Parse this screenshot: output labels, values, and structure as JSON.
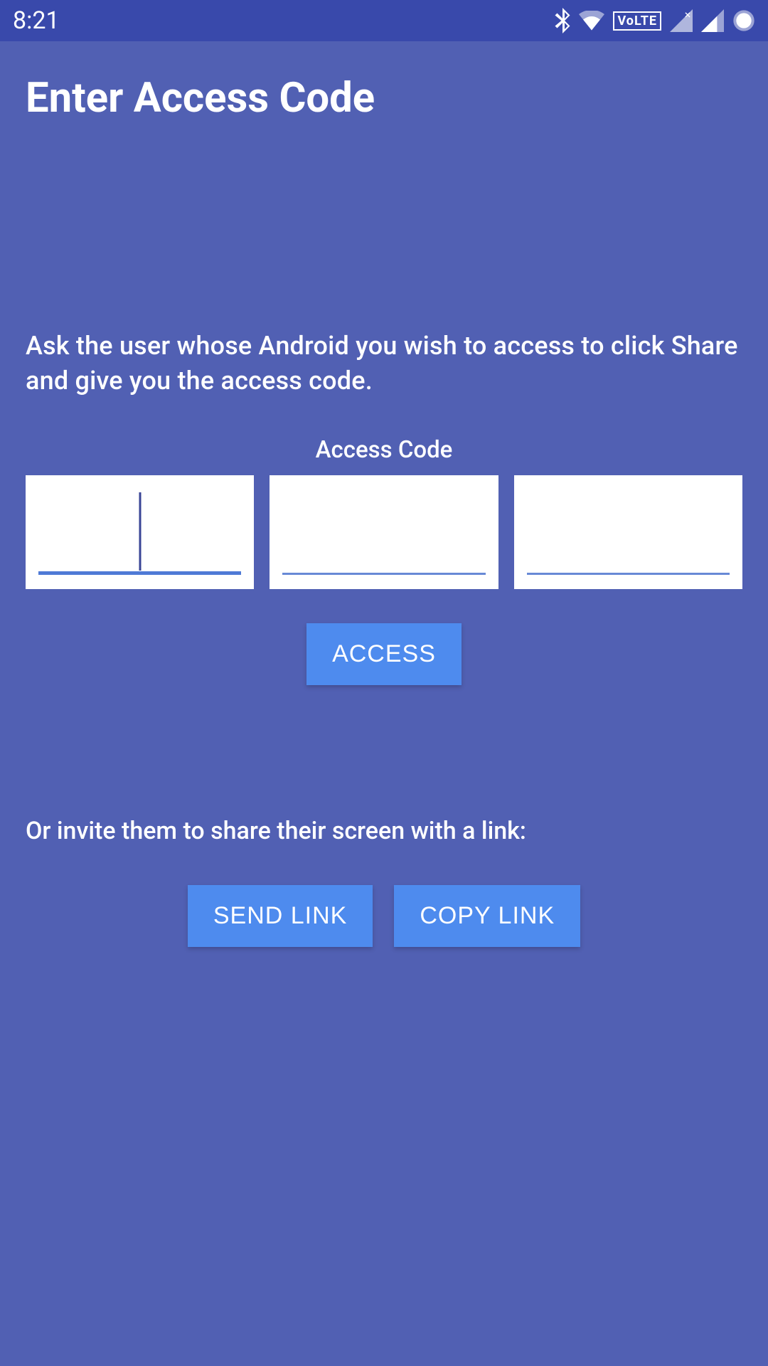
{
  "status": {
    "time": "8:21",
    "volte": "VoLTE"
  },
  "page": {
    "title": "Enter Access Code",
    "instruction": "Ask the user whose Android you wish to access to click Share and give you the access code.",
    "access_code_label": "Access Code",
    "access_button": "ACCESS",
    "invite_text": "Or invite them to share their screen with a link:",
    "send_link_button": "SEND LINK",
    "copy_link_button": "COPY LINK"
  },
  "inputs": {
    "code1": "",
    "code2": "",
    "code3": ""
  }
}
